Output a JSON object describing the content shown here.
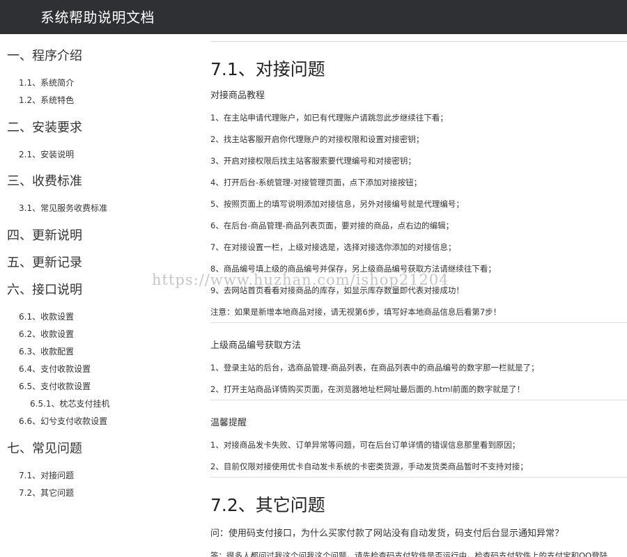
{
  "header": {
    "title": "系统帮助说明文档"
  },
  "sidebar": {
    "sections": [
      {
        "label": "一、程序介绍",
        "items": [
          {
            "label": "1.1、系统简介"
          },
          {
            "label": "1.2、系统特色"
          }
        ]
      },
      {
        "label": "二、安装要求",
        "items": [
          {
            "label": "2.1、安装说明"
          }
        ]
      },
      {
        "label": "三、收费标准",
        "items": [
          {
            "label": "3.1、常见服务收费标准"
          }
        ]
      },
      {
        "label": "四、更新说明",
        "items": []
      },
      {
        "label": "五、更新记录",
        "items": []
      },
      {
        "label": "六、接口说明",
        "items": [
          {
            "label": "6.1、收款设置"
          },
          {
            "label": "6.2、收款设置"
          },
          {
            "label": "6.3、收款配置"
          },
          {
            "label": "6.4、支付收款设置"
          },
          {
            "label": "6.5、支付收款设置"
          },
          {
            "label": "6.5.1、枕芯支付挂机"
          },
          {
            "label": "6.6、幻兮支付收款设置"
          }
        ]
      },
      {
        "label": "七、常见问题",
        "items": [
          {
            "label": "7.1、对接问题"
          },
          {
            "label": "7.2、其它问题"
          }
        ]
      }
    ]
  },
  "content": {
    "section1_title": "7.1、对接问题",
    "block1": {
      "title": "对接商品教程",
      "lines": [
        "1、在主站申请代理账户，如已有代理账户请跳忽此步继续往下看；",
        "2、找主站客服开启你代理账户的对接权限和设置对接密钥；",
        "3、开启对接权限后找主站客服索要代理编号和对接密钥；",
        "4、打开后台-系统管理-对接管理页面，点下添加对接按钮；",
        "5、按照页面上的填写说明添加对接信息，另外对接编号就是代理编号；",
        "6、在后台-商品管理-商品列表页面，要对接的商品，点右边的编辑；",
        "7、在对接设置一栏，上级对接选是，选择对接选你添加的对接信息；",
        "8、商品编号填上级的商品编号并保存，另上级商品编号获取方法请继续往下看；",
        "9、去网站首页看看对接商品的库存，如显示库存数量即代表对接成功！",
        "注意：如果是新增本地商品对接，请无视第6步，填写好本地商品信息后看第7步！"
      ]
    },
    "block2": {
      "title": "上级商品编号获取方法",
      "lines": [
        "1、登录主站的后台，选商品管理-商品列表，在商品列表中的商品编号的数字那一栏就是了；",
        "2、打开主站商品详情购买页面，在浏览器地址栏网址最后面的.html前面的数字就是了！"
      ]
    },
    "block3": {
      "title": "温馨提醒",
      "lines": [
        "1、对接商品发卡失败、订单异常等问题，可在后台订单详情的错误信息那里看到原因；",
        "2、目前仅限对接使用优卡自动发卡系统的卡密类货源，手动发货类商品暂时不支持对接；"
      ]
    },
    "section2_title": "7.2、其它问题",
    "question": "问：使用码支付接口，为什么买家付款了网站没有自动发货，码支付后台显示通知异常？",
    "answer": "答：很多人都问过我这个问我这个问题，请先检查码支付软件是否运行中，检查码支付软件上的支付宝和QQ登陆"
  },
  "watermark": "https://www.huzhan.com/ishop21204"
}
